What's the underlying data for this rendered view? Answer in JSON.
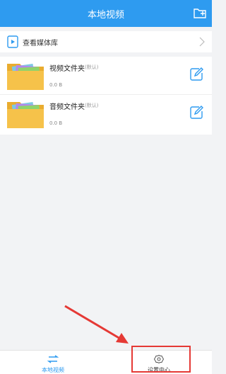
{
  "header": {
    "title": "本地视频"
  },
  "media_library": {
    "label": "查看媒体库"
  },
  "folders": [
    {
      "name": "视频文件夹",
      "tag": "(默认)",
      "size": "0.0 B"
    },
    {
      "name": "音频文件夹",
      "tag": "(默认)",
      "size": "0.0 B"
    }
  ],
  "tabs": [
    {
      "label": "本地视频",
      "active": true
    },
    {
      "label": "设置中心",
      "active": false
    }
  ],
  "colors": {
    "accent": "#2e9bf0",
    "highlight": "#e53935",
    "folder": "#f6c24a"
  }
}
